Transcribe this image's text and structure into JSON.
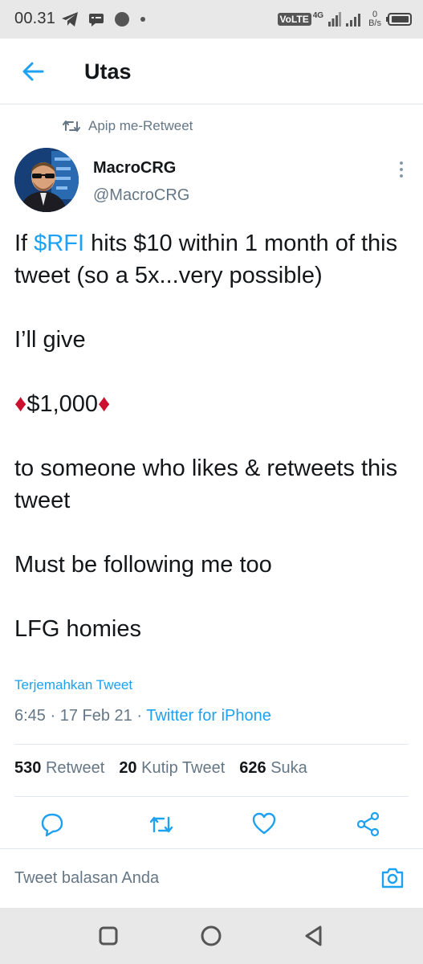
{
  "status_bar": {
    "time": "00.31",
    "network": "4G",
    "volte": "VoLTE",
    "data_rate_value": "0",
    "data_rate_unit": "B/s"
  },
  "header": {
    "title": "Utas"
  },
  "retweet_context": {
    "text": "Apip me-Retweet"
  },
  "author": {
    "name": "MacroCRG",
    "handle": "@MacroCRG"
  },
  "tweet": {
    "line1_prefix": "If ",
    "cashtag": "$RFI",
    "line1_suffix": " hits $10 within 1 month of this tweet (so a 5x...very possible)",
    "line2": "I’ll give",
    "amount": "$1,000",
    "line4": "to someone who likes & retweets this tweet",
    "line5": "Must be following me too",
    "line6": "LFG homies"
  },
  "translate_link": "Terjemahkan Tweet",
  "meta": {
    "time": "6:45",
    "separator1": " · ",
    "date": "17 Feb 21",
    "separator2": " · ",
    "source": "Twitter for iPhone"
  },
  "stats": {
    "retweets_count": "530",
    "retweets_label": "Retweet",
    "quotes_count": "20",
    "quotes_label": "Kutip Tweet",
    "likes_count": "626",
    "likes_label": "Suka"
  },
  "reply": {
    "placeholder": "Tweet balasan Anda"
  },
  "icons": {
    "back": "arrow-left-icon",
    "retweet": "retweet-icon",
    "more": "more-vertical-icon",
    "reply": "reply-icon",
    "like": "heart-icon",
    "share": "share-icon",
    "camera": "camera-icon"
  },
  "colors": {
    "accent": "#1da1f2",
    "secondary_text": "#657786",
    "primary_text": "#14171a",
    "diamond": "#cc1030"
  }
}
